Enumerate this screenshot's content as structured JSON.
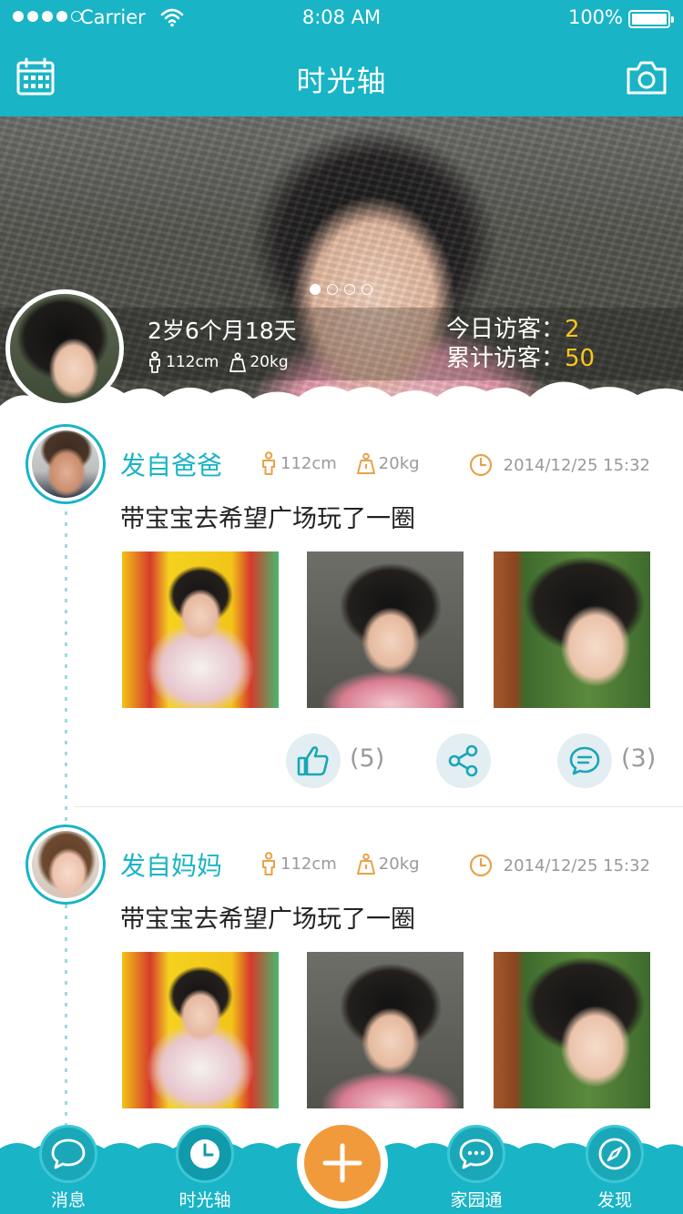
{
  "status_bar": {
    "carrier": "Carrier",
    "time": "8:08 AM",
    "battery": "100%"
  },
  "nav": {
    "title": "时光轴",
    "left_icon": "calendar-icon",
    "right_icon": "camera-icon"
  },
  "profile": {
    "age": "2岁6个月18天",
    "height": "112cm",
    "weight": "20kg",
    "today_visitors_label": "今日访客：",
    "today_visitors": "2",
    "total_visitors_label": "累计访客：",
    "total_visitors": "50",
    "carousel_pages": 4,
    "carousel_active": 1
  },
  "posts": [
    {
      "author": "发自爸爸",
      "height": "112cm",
      "weight": "20kg",
      "datetime": "2014/12/25 15:32",
      "text": "带宝宝去希望广场玩了一圈",
      "like_count": "(5)",
      "comment_count": "(3)"
    },
    {
      "author": "发自妈妈",
      "height": "112cm",
      "weight": "20kg",
      "datetime": "2014/12/25 15:32",
      "text": "带宝宝去希望广场玩了一圈"
    }
  ],
  "tabbar": {
    "items": [
      {
        "label": "消息",
        "icon": "message-icon"
      },
      {
        "label": "时光轴",
        "icon": "clock-icon",
        "active": true
      },
      {
        "label": "家园通",
        "icon": "chat-bubbles-icon"
      },
      {
        "label": "发现",
        "icon": "compass-icon"
      }
    ],
    "add_icon": "plus-icon"
  },
  "colors": {
    "primary": "#19b4c6",
    "accent_orange": "#f19a3c",
    "highlight_yellow": "#f9c61d",
    "meta_orange": "#e8a24a"
  }
}
